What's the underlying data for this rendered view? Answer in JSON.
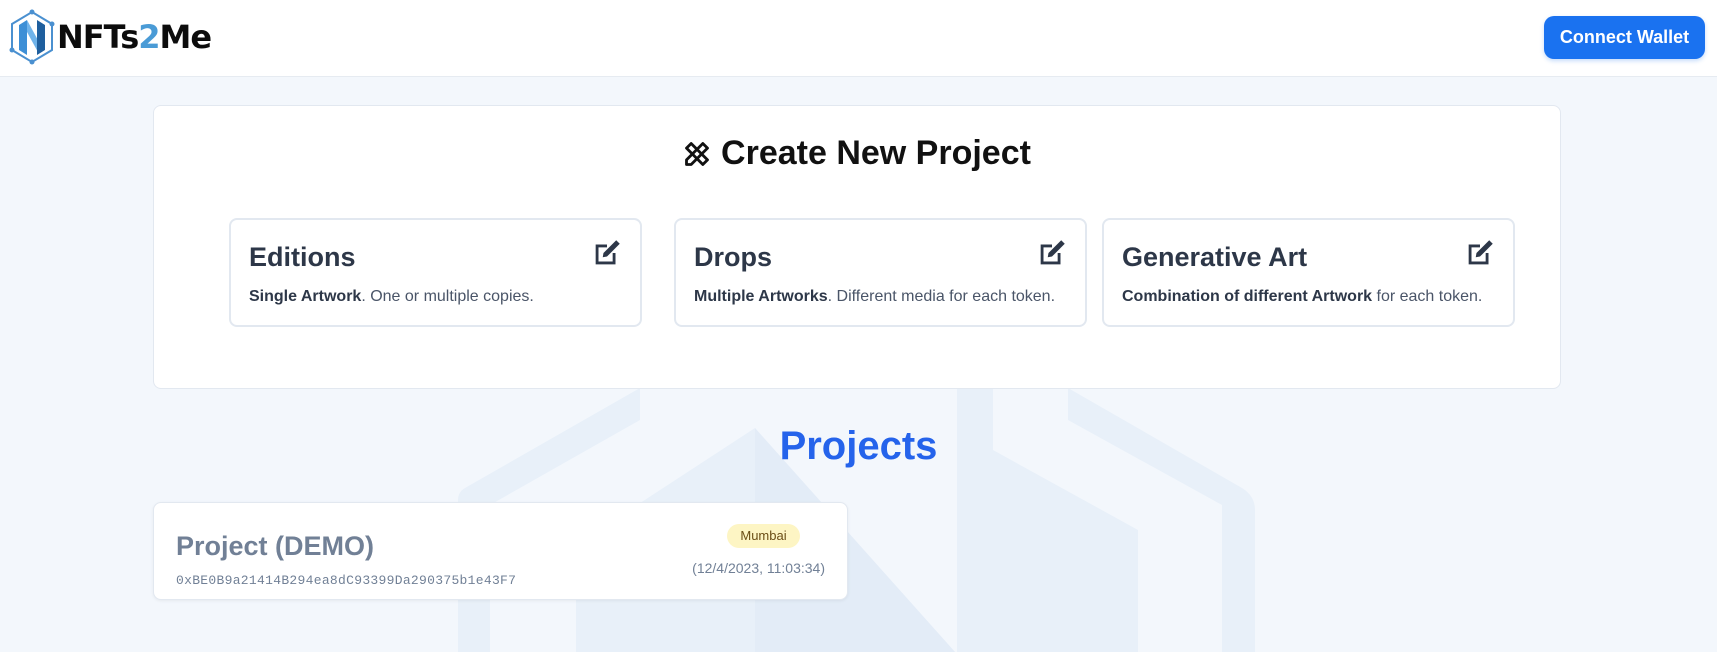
{
  "header": {
    "logo_text_a": "NFTs",
    "logo_text_b": "2",
    "logo_text_c": "Me",
    "connect_label": "Connect Wallet"
  },
  "create": {
    "title": "Create New Project",
    "title_icon": "pencil-ruler-icon",
    "types": [
      {
        "title": "Editions",
        "bold": "Single Artwork",
        "rest": ". One or multiple copies.",
        "icon": "edit-icon"
      },
      {
        "title": "Drops",
        "bold": "Multiple Artworks",
        "rest": ". Different media for each token.",
        "icon": "edit-icon"
      },
      {
        "title": "Generative Art",
        "bold": "Combination of different Artwork",
        "rest": " for each token.",
        "icon": "edit-icon"
      }
    ]
  },
  "projects": {
    "heading": "Projects",
    "items": [
      {
        "name": "Project (DEMO)",
        "address": "0xBE0B9a21414B294ea8dC93399Da290375b1e43F7",
        "network": "Mumbai",
        "date": "(12/4/2023, 11:03:34)"
      }
    ]
  },
  "colors": {
    "accent": "#1a72f0",
    "heading_blue": "#2563eb",
    "badge_bg": "#fdf5c4",
    "page_bg": "#f3f7fc"
  }
}
